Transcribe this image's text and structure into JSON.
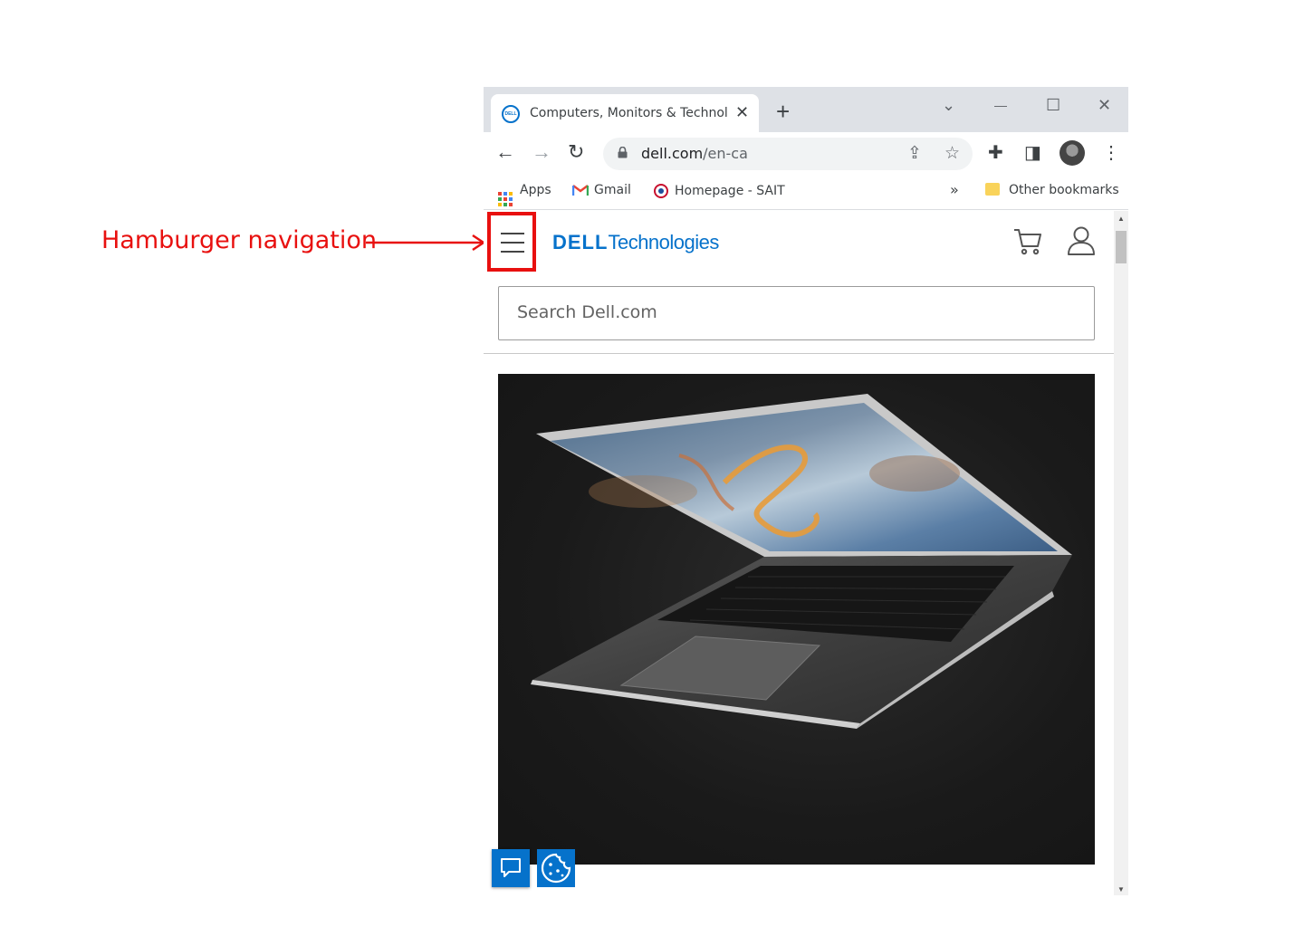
{
  "annotation": {
    "label": "Hamburger navigation",
    "color": "#e8100f"
  },
  "browser": {
    "tab": {
      "title": "Computers, Monitors & Technolo",
      "favicon_text": "DELL",
      "close_glyph": "✕"
    },
    "new_tab_glyph": "+",
    "window_controls": {
      "dropdown": "⌄",
      "minimize": "—",
      "maximize": "☐",
      "close": "✕"
    },
    "toolbar": {
      "back": "←",
      "forward": "→",
      "reload": "↻",
      "url_host": "dell.com",
      "url_path": "/en-ca",
      "share_icon": "⇪",
      "star_icon": "☆",
      "extensions_icon": "✚",
      "sidepanel_icon": "◨",
      "menu_icon": "⋮"
    },
    "bookmarks": {
      "apps": "Apps",
      "gmail": "Gmail",
      "homepage": "Homepage - SAIT",
      "overflow": "»",
      "other": "Other bookmarks"
    }
  },
  "site": {
    "logo_dell": "DELL",
    "logo_technologies": "Technologies",
    "search_placeholder": "Search Dell.com",
    "brand_color": "#0672cb"
  }
}
